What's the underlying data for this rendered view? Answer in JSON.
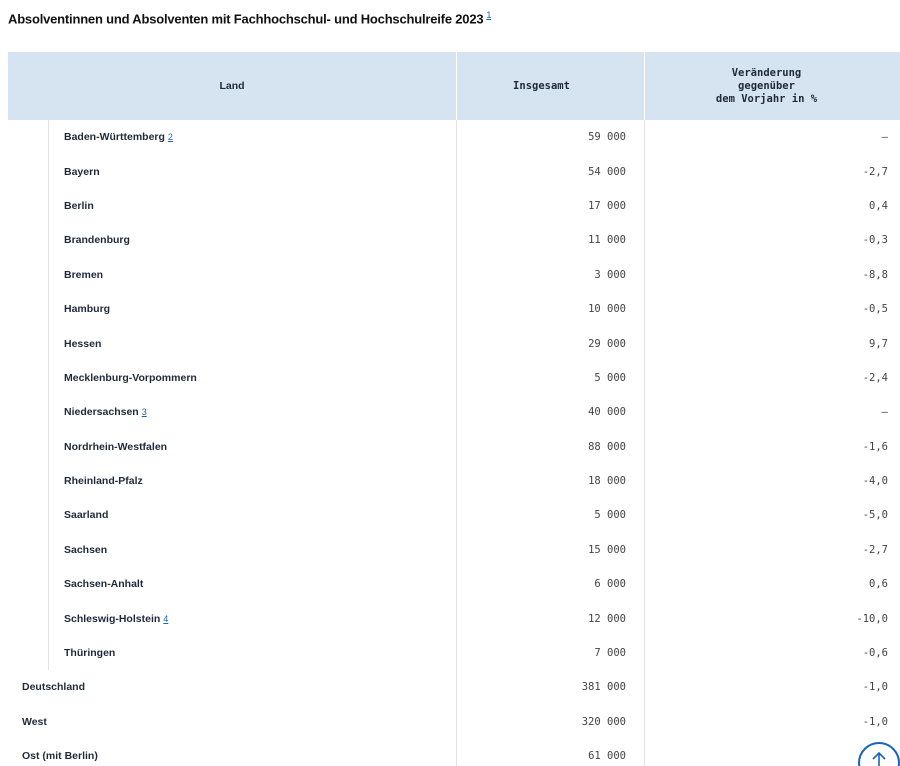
{
  "title": "Absolventinnen und Absolventen mit Fachhochschul- und Hochschulreife 2023",
  "title_footnote": "1",
  "headers": {
    "land": "Land",
    "insgesamt": "Insgesamt",
    "veraenderung_line1": "Veränderung",
    "veraenderung_line2": "gegenüber",
    "veraenderung_line3": "dem Vorjahr in %"
  },
  "rows": [
    {
      "land": "Baden-Württemberg",
      "fn": "2",
      "insgesamt": "59 000",
      "veraenderung": "–"
    },
    {
      "land": "Bayern",
      "fn": "",
      "insgesamt": "54 000",
      "veraenderung": "-2,7"
    },
    {
      "land": "Berlin",
      "fn": "",
      "insgesamt": "17 000",
      "veraenderung": "0,4"
    },
    {
      "land": "Brandenburg",
      "fn": "",
      "insgesamt": "11 000",
      "veraenderung": "-0,3"
    },
    {
      "land": "Bremen",
      "fn": "",
      "insgesamt": "3 000",
      "veraenderung": "-8,8"
    },
    {
      "land": "Hamburg",
      "fn": "",
      "insgesamt": "10 000",
      "veraenderung": "-0,5"
    },
    {
      "land": "Hessen",
      "fn": "",
      "insgesamt": "29 000",
      "veraenderung": "9,7"
    },
    {
      "land": "Mecklenburg-Vorpommern",
      "fn": "",
      "insgesamt": "5 000",
      "veraenderung": "-2,4"
    },
    {
      "land": "Niedersachsen",
      "fn": "3",
      "insgesamt": "40 000",
      "veraenderung": "–"
    },
    {
      "land": "Nordrhein-Westfalen",
      "fn": "",
      "insgesamt": "88 000",
      "veraenderung": "-1,6"
    },
    {
      "land": "Rheinland-Pfalz",
      "fn": "",
      "insgesamt": "18 000",
      "veraenderung": "-4,0"
    },
    {
      "land": "Saarland",
      "fn": "",
      "insgesamt": "5 000",
      "veraenderung": "-5,0"
    },
    {
      "land": "Sachsen",
      "fn": "",
      "insgesamt": "15 000",
      "veraenderung": "-2,7"
    },
    {
      "land": "Sachsen-Anhalt",
      "fn": "",
      "insgesamt": "6 000",
      "veraenderung": "0,6"
    },
    {
      "land": "Schleswig-Holstein",
      "fn": "4",
      "insgesamt": "12 000",
      "veraenderung": "-10,0"
    },
    {
      "land": "Thüringen",
      "fn": "",
      "insgesamt": "7 000",
      "veraenderung": "-0,6"
    }
  ],
  "totals": [
    {
      "land": "Deutschland",
      "insgesamt": "381 000",
      "veraenderung": "-1,0"
    },
    {
      "land": "West",
      "insgesamt": "320 000",
      "veraenderung": "-1,0"
    },
    {
      "land": "Ost (mit Berlin)",
      "insgesamt": "61 000",
      "veraenderung": ""
    }
  ],
  "icons": {
    "scroll_top": "arrow-up-icon"
  },
  "colors": {
    "header_bg": "#d6e4f2",
    "link": "#1565c0"
  }
}
